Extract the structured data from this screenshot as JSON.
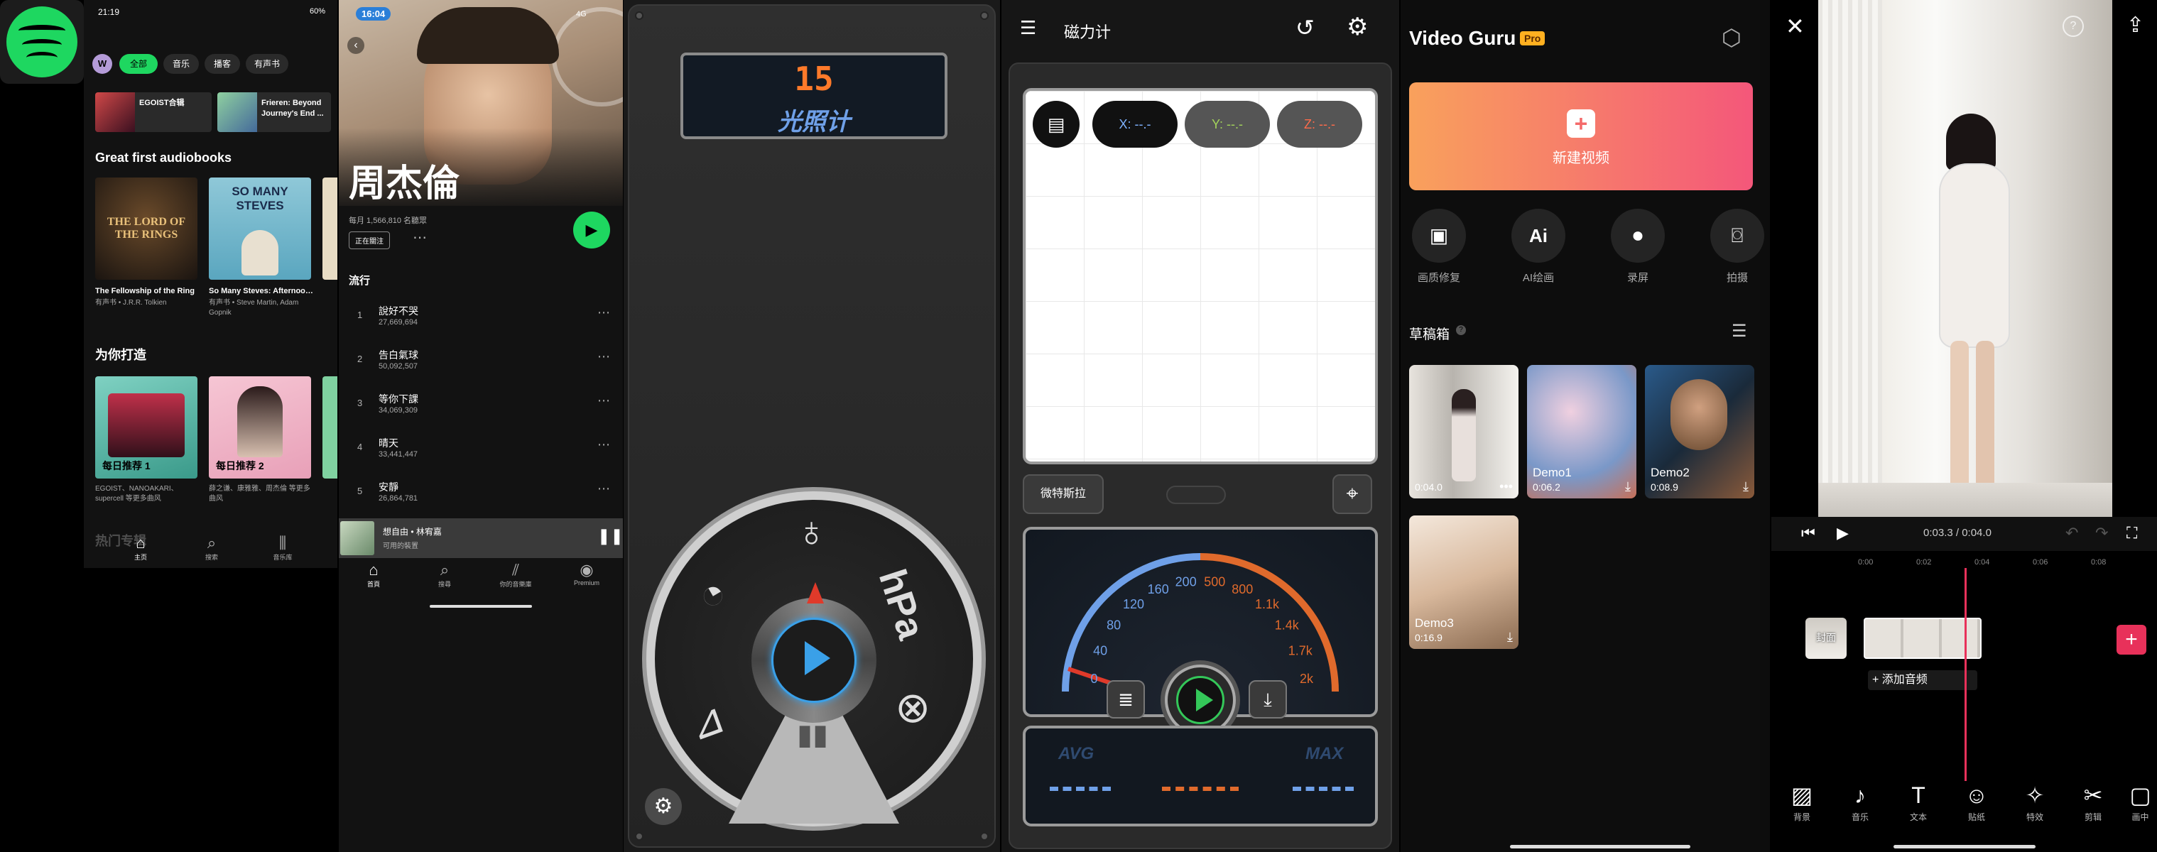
{
  "spotify": {
    "status_time": "21:19",
    "status_battery": "60%",
    "avatar_letter": "W",
    "filter_chips": [
      "全部",
      "音乐",
      "播客",
      "有声书"
    ],
    "shortcuts": [
      "EGOIST合辑",
      "Frieren: Beyond Journey's End ..."
    ],
    "section1_title": "Great first audiobooks",
    "audiobooks": [
      {
        "title": "The Fellowship of the Ring",
        "subtitle": "有声书 • J.R.R. Tolkien",
        "art_text": "THE LORD OF THE RINGS"
      },
      {
        "title": "So Many Steves: Afternoon...",
        "subtitle": "有声书 • Steve Martin, Adam Gopnik",
        "art_text": "SO MANY STEVES"
      }
    ],
    "section2_title": "为你打造",
    "mixes": [
      {
        "label": "每日推荐 1",
        "subtitle": "EGOIST、NANOAKARI、supercell 等更多曲风"
      },
      {
        "label": "每日推荐 2",
        "subtitle": "薛之谦、康雅雅、周杰倫 等更多曲风"
      }
    ],
    "section3_title": "热门专辑",
    "nav": [
      "主页",
      "搜索",
      "音乐库"
    ]
  },
  "artist": {
    "status_time": "16:04",
    "status_signal": "4G",
    "artist_name": "周杰倫",
    "monthly_listeners": "每月 1,566,810 名聽眾",
    "follow_label": "正在關注",
    "section_title": "流行",
    "tracks": [
      {
        "n": "1",
        "name": "說好不哭",
        "plays": "27,669,694"
      },
      {
        "n": "2",
        "name": "告白氣球",
        "plays": "50,092,507"
      },
      {
        "n": "3",
        "name": "等你下課",
        "plays": "34,069,309"
      },
      {
        "n": "4",
        "name": "晴天",
        "plays": "33,441,447"
      },
      {
        "n": "5",
        "name": "安靜",
        "plays": "26,864,781"
      }
    ],
    "now_playing_title": "想自由 • 林宥嘉",
    "now_playing_device": "可用的裝置",
    "nav": [
      "首頁",
      "搜尋",
      "你的音樂庫",
      "Premium"
    ]
  },
  "lightmeter": {
    "display_value": "15",
    "display_label": "光照计",
    "dial_unit": "hPa"
  },
  "magnetometer": {
    "title": "磁力计",
    "axes": [
      {
        "label": "X: --.-",
        "color": "#7fb2ff"
      },
      {
        "label": "Y: --.-",
        "color": "#a3d35b"
      },
      {
        "label": "Z: --.-",
        "color": "#ff6b4a"
      }
    ],
    "unit_button": "微特斯拉",
    "gauge_ticks": [
      "0",
      "40",
      "80",
      "120",
      "160",
      "200",
      "500",
      "800",
      "1.1k",
      "1.4k",
      "1.7k",
      "2k"
    ],
    "avg_label": "AVG",
    "max_label": "MAX",
    "colors": {
      "blue": "#6fa0e8",
      "orange": "#e06a2c"
    }
  },
  "videoguru": {
    "brand": "Video Guru",
    "badge": "Pro",
    "new_video": "新建视频",
    "tools": [
      "画质修复",
      "AI绘画",
      "录屏",
      "拍摄"
    ],
    "drafts_title": "草稿箱",
    "drafts": [
      {
        "name": "",
        "duration": "0:04.0"
      },
      {
        "name": "Demo1",
        "duration": "0:06.2"
      },
      {
        "name": "Demo2",
        "duration": "0:08.9"
      },
      {
        "name": "Demo3",
        "duration": "0:16.9"
      }
    ],
    "accent_gradient": [
      "#f9a15c",
      "#f4577a"
    ]
  },
  "editor": {
    "time_display": "0:03.3 / 0:04.0",
    "ruler_ticks": [
      "0:00",
      "0:02",
      "0:04",
      "0:06",
      "0:08"
    ],
    "cover_label": "封面",
    "add_audio": "+ 添加音频",
    "toolbar": [
      "背景",
      "音乐",
      "文本",
      "贴纸",
      "特效",
      "剪辑",
      "画中"
    ],
    "accent": "#e8315a"
  }
}
